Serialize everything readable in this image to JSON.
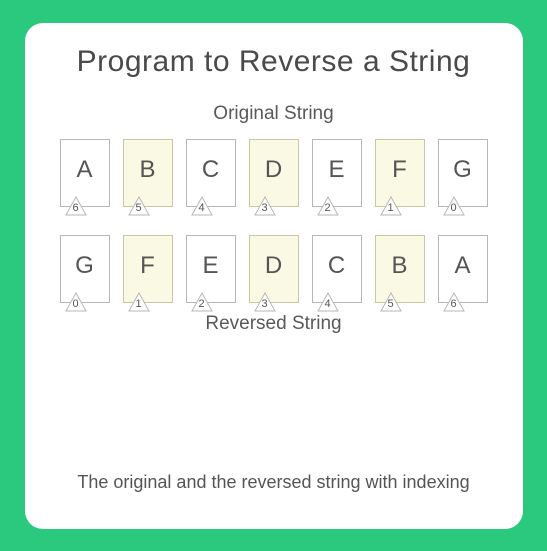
{
  "title": "Program to Reverse a String",
  "labels": {
    "original": "Original String",
    "reversed": "Reversed String"
  },
  "rows": {
    "original": [
      {
        "letter": "A",
        "index": 6,
        "highlight": false
      },
      {
        "letter": "B",
        "index": 5,
        "highlight": true
      },
      {
        "letter": "C",
        "index": 4,
        "highlight": false
      },
      {
        "letter": "D",
        "index": 3,
        "highlight": true
      },
      {
        "letter": "E",
        "index": 2,
        "highlight": false
      },
      {
        "letter": "F",
        "index": 1,
        "highlight": true
      },
      {
        "letter": "G",
        "index": 0,
        "highlight": false
      }
    ],
    "reversed": [
      {
        "letter": "G",
        "index": 0,
        "highlight": false
      },
      {
        "letter": "F",
        "index": 1,
        "highlight": true
      },
      {
        "letter": "E",
        "index": 2,
        "highlight": false
      },
      {
        "letter": "D",
        "index": 3,
        "highlight": true
      },
      {
        "letter": "C",
        "index": 4,
        "highlight": false
      },
      {
        "letter": "B",
        "index": 5,
        "highlight": true
      },
      {
        "letter": "A",
        "index": 6,
        "highlight": false
      }
    ]
  },
  "caption": "The original and the reversed string with indexing"
}
